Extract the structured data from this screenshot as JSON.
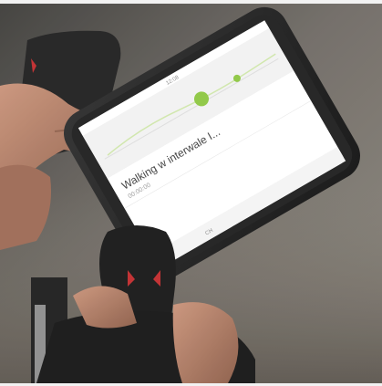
{
  "photo": {
    "screen": {
      "title": "Walking w interwale I...",
      "subtitle": "00:00:00",
      "status_time": "12:08",
      "bottom_label": "CH"
    },
    "colors": {
      "accent_green": "#8cc63f",
      "background_fog": "#6f6a63"
    }
  }
}
